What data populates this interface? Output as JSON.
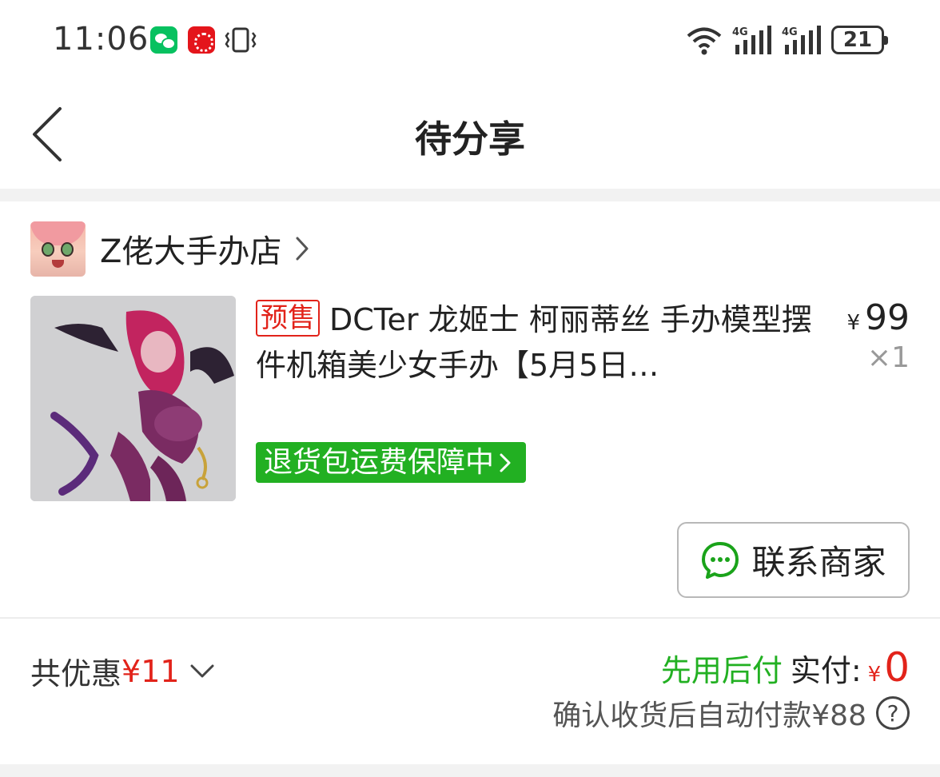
{
  "status_bar": {
    "time": "11:06",
    "battery": "21",
    "icons": [
      "wechat-icon",
      "red-app-icon",
      "vibrate-icon",
      "wifi-icon",
      "signal-4g-icon",
      "signal-4g-icon",
      "battery-icon"
    ]
  },
  "nav": {
    "title": "待分享",
    "back_icon": "chevron-left-icon"
  },
  "order": {
    "store_name": "Z佬大手办店",
    "product": {
      "tag": "预售",
      "title": "DCTer 龙姬士 柯丽蒂丝 手办模型摆件机箱美少女手办【5月5日…",
      "price_symbol": "¥",
      "price": "99",
      "quantity": "×1"
    },
    "return_badge": "退货包运费保障中",
    "contact_label": "联系商家"
  },
  "summary": {
    "discount_label": "共优惠",
    "discount_amount": "¥11",
    "pay_later": "先用后付",
    "actual_pay_label": "实付:",
    "currency": "¥",
    "actual_pay_amount": "0",
    "confirm_text": "确认收货后自动付款¥88",
    "help_symbol": "?"
  },
  "colors": {
    "accent_red": "#e2231a",
    "green": "#22b022",
    "background_gray": "#f2f2f2"
  }
}
